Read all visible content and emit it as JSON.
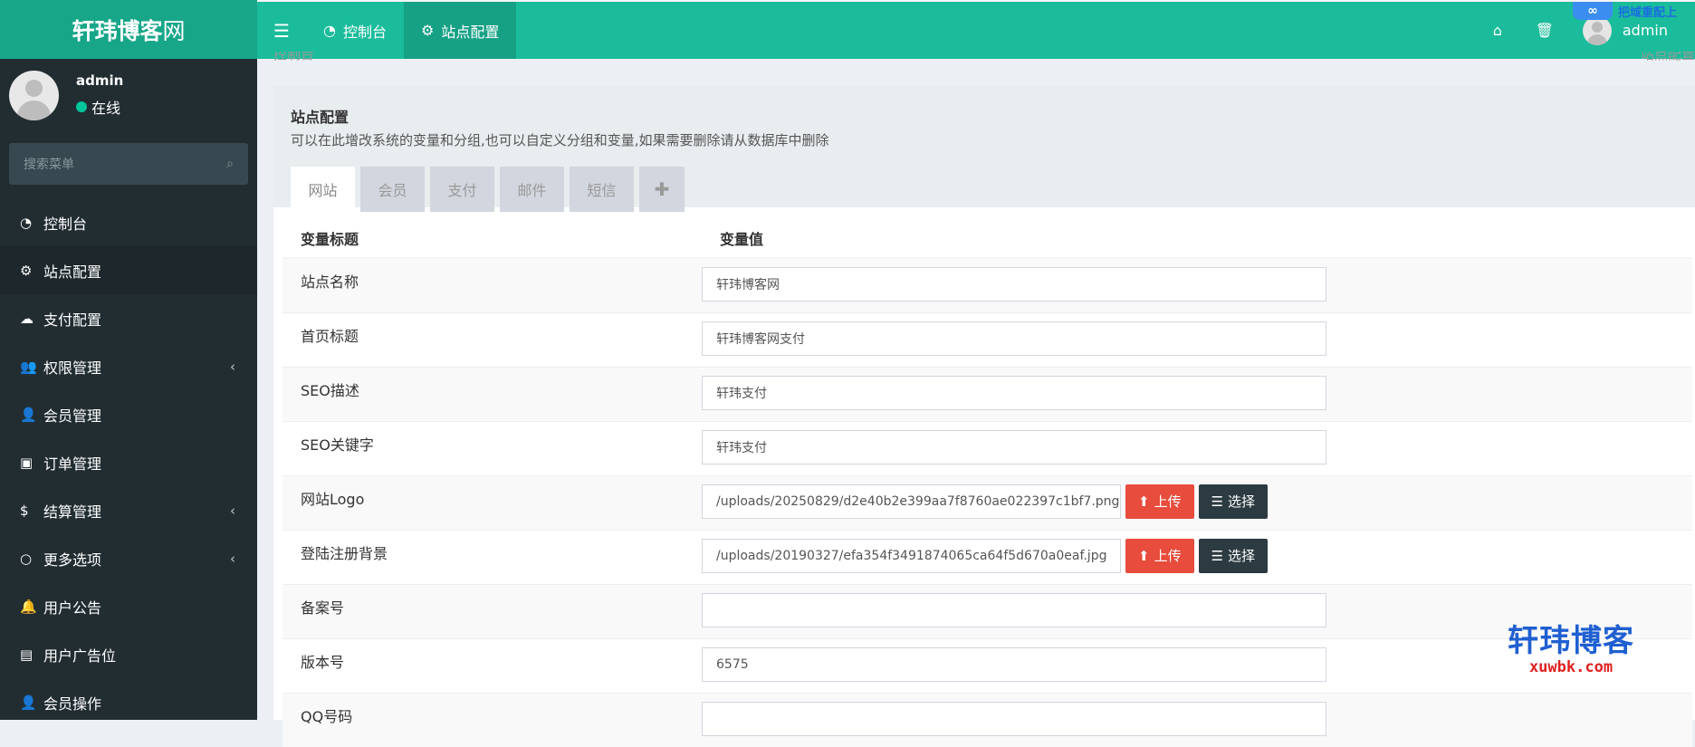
{
  "brand": {
    "bold": "轩玮博客",
    "light": "网"
  },
  "topbar": {
    "menu_icon": "bars-icon",
    "tabs": [
      {
        "icon": "dashboard-icon",
        "label": "控制台",
        "active": false
      },
      {
        "icon": "gear-icon",
        "label": "站点配置",
        "active": true
      }
    ],
    "right_icons": [
      "home-icon",
      "trash-icon"
    ],
    "username": "admin",
    "corner_badge": "把域重配上"
  },
  "sidebar": {
    "user": {
      "name": "admin",
      "status": "在线"
    },
    "search_placeholder": "搜索菜单",
    "items": [
      {
        "icon": "dashboard-icon",
        "label": "控制台",
        "caret": false,
        "active": false
      },
      {
        "icon": "gear-icon",
        "label": "站点配置",
        "caret": false,
        "active": true
      },
      {
        "icon": "cloud-icon",
        "label": "支付配置",
        "caret": false,
        "active": false
      },
      {
        "icon": "users-icon",
        "label": "权限管理",
        "caret": true,
        "active": false
      },
      {
        "icon": "user-icon",
        "label": "会员管理",
        "caret": false,
        "active": false
      },
      {
        "icon": "briefcase-icon",
        "label": "订单管理",
        "caret": false,
        "active": false
      },
      {
        "icon": "dollar-icon",
        "label": "结算管理",
        "caret": true,
        "active": false
      },
      {
        "icon": "circle-icon",
        "label": "更多选项",
        "caret": true,
        "active": false
      },
      {
        "icon": "bell-icon",
        "label": "用户公告",
        "caret": false,
        "active": false
      },
      {
        "icon": "archive-icon",
        "label": "用户广告位",
        "caret": false,
        "active": false
      },
      {
        "icon": "user-icon",
        "label": "会员操作",
        "caret": false,
        "active": false
      }
    ]
  },
  "breadcrumb": {
    "left": "控制台",
    "right": "站点配置"
  },
  "panel": {
    "title": "站点配置",
    "description": "可以在此增改系统的变量和分组,也可以自定义分组和变量,如果需要删除请从数据库中删除",
    "tabs": [
      "网站",
      "会员",
      "支付",
      "邮件",
      "短信"
    ],
    "active_tab": "网站",
    "add_tab_icon": "plus-icon"
  },
  "table": {
    "headers": [
      "变量标题",
      "变量值"
    ],
    "rows": [
      {
        "label": "站点名称",
        "value": "轩玮博客网",
        "buttons": false
      },
      {
        "label": "首页标题",
        "value": "轩玮博客网支付",
        "buttons": false
      },
      {
        "label": "SEO描述",
        "value": "轩玮支付",
        "buttons": false
      },
      {
        "label": "SEO关键字",
        "value": "轩玮支付",
        "buttons": false
      },
      {
        "label": "网站Logo",
        "value": "/uploads/20250829/d2e40b2e399aa7f8760ae022397c1bf7.png",
        "buttons": true
      },
      {
        "label": "登陆注册背景",
        "value": "/uploads/20190327/efa354f3491874065ca64f5d670a0eaf.jpg",
        "buttons": true
      },
      {
        "label": "备案号",
        "value": "",
        "buttons": false
      },
      {
        "label": "版本号",
        "value": "6575",
        "buttons": false
      },
      {
        "label": "QQ号码",
        "value": "",
        "buttons": false
      }
    ],
    "upload_label": "上传",
    "select_label": "选择"
  },
  "watermark": {
    "cn": "轩玮博客",
    "en": "xuwbk.com"
  },
  "colors": {
    "header": "#1bbc9b",
    "logo_bg": "#18a689",
    "sidebar": "#222d32",
    "danger": "#e74c3c",
    "dark_btn": "#2c3b41"
  }
}
